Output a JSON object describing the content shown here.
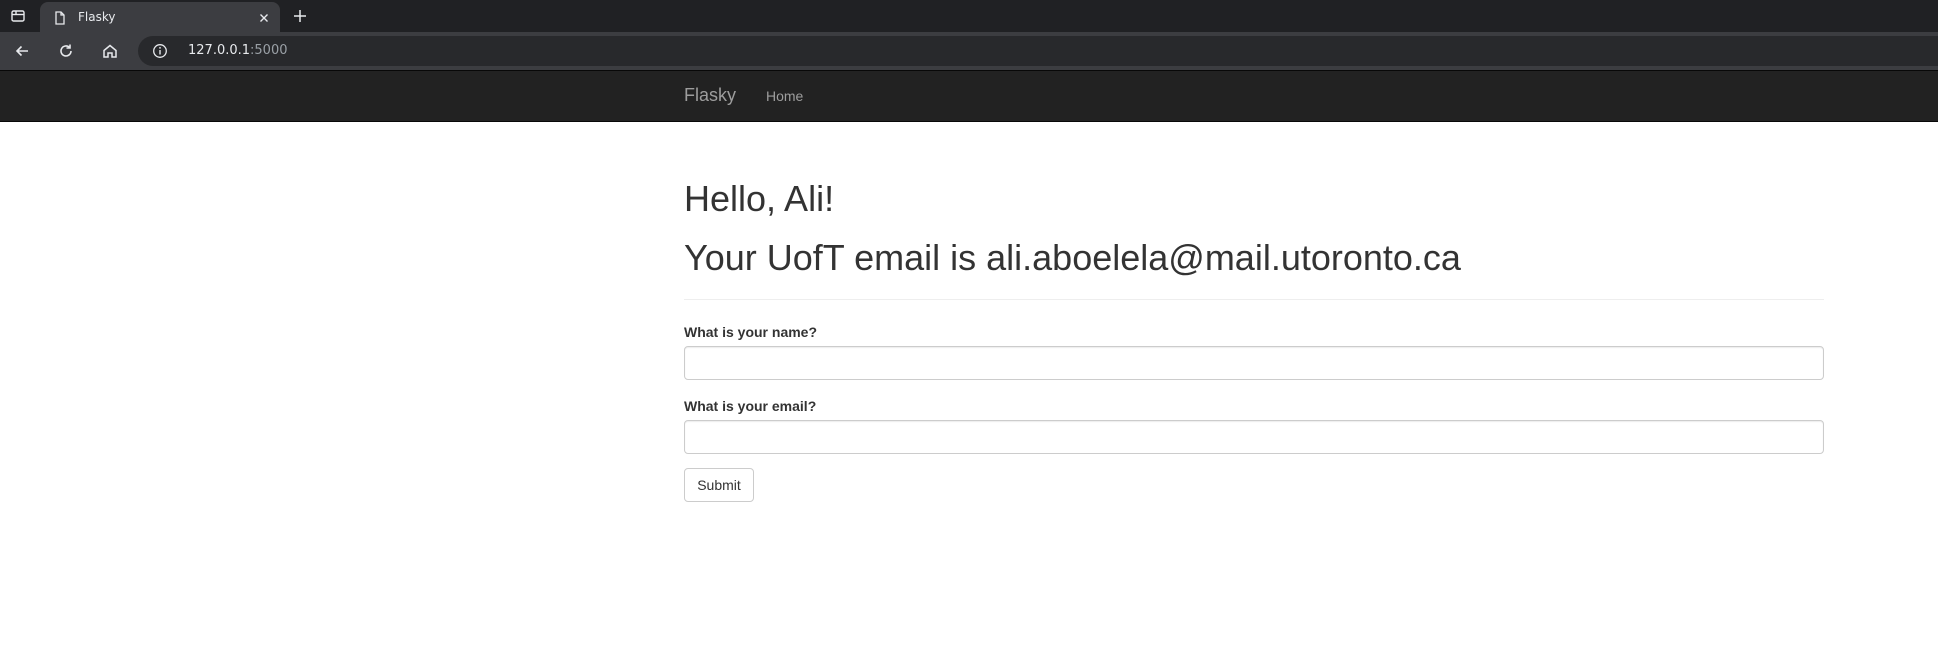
{
  "browser": {
    "tab_title": "Flasky",
    "url_host": "127.0.0.1",
    "url_port": ":5000",
    "icons": {
      "tab_switcher": "tab-switcher-icon",
      "favicon": "page-icon",
      "close": "close-icon",
      "new_tab": "plus-icon",
      "back": "back-arrow-icon",
      "reload": "reload-icon",
      "home": "home-icon",
      "info": "info-icon"
    }
  },
  "navbar": {
    "brand": "Flasky",
    "home_link": "Home",
    "background": "#222222"
  },
  "main": {
    "greeting": "Hello, Ali!",
    "email_message": "Your UofT email is ali.aboelela@mail.utoronto.ca",
    "form": {
      "name_label": "What is your name?",
      "name_value": "",
      "email_label": "What is your email?",
      "email_value": "",
      "submit_label": "Submit"
    }
  }
}
